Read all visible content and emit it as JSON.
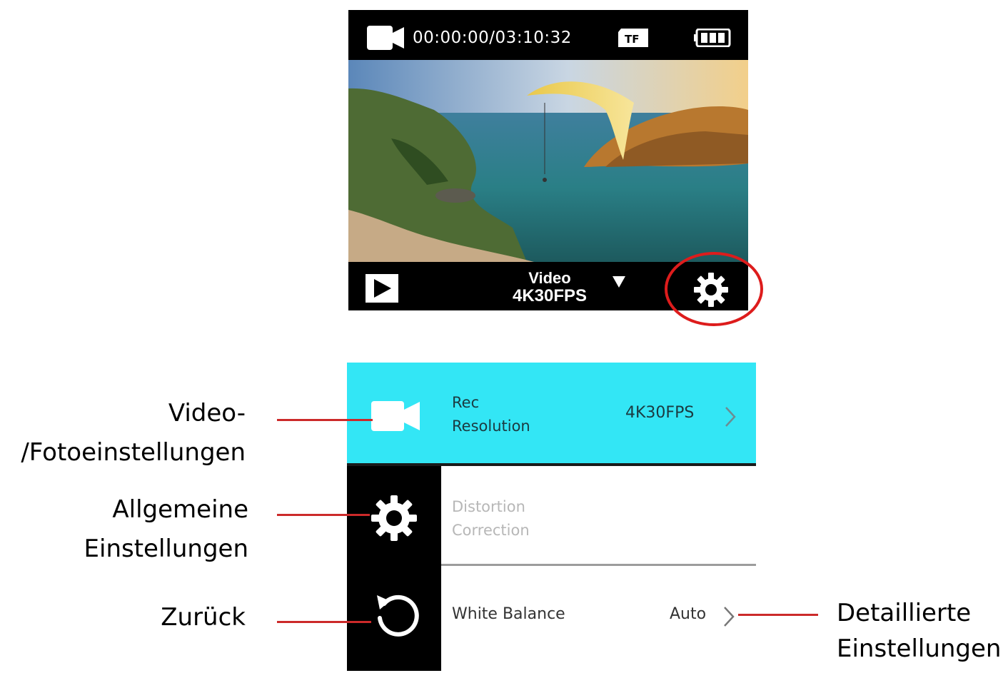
{
  "camera_screen": {
    "icons": {
      "mode": "video-camera-icon",
      "storage": "tf-card-icon",
      "battery": "battery-icon",
      "play": "play-icon",
      "dropdown": "triangle-down-icon",
      "settings": "gear-icon"
    },
    "timecode": "00:00:00/03:10:32",
    "storage_label": "TF",
    "battery_level": 1.0,
    "mode_line1": "Video",
    "mode_line2": "4K30FPS",
    "highlight_color": "#dd1c1c"
  },
  "settings_menu": {
    "accent_color": "#33e6f5",
    "sidebar_icons": [
      "video-camera-icon",
      "gear-icon",
      "back-arrow-icon"
    ],
    "items": [
      {
        "label_line1": "Rec",
        "label_line2": "Resolution",
        "value": "4K30FPS",
        "active": true
      },
      {
        "label_line1": "Distortion",
        "label_line2": "Correction",
        "value": "",
        "active": false
      },
      {
        "label_line1": "White Balance",
        "label_line2": "",
        "value": "Auto",
        "active": false
      }
    ]
  },
  "annotations": {
    "video_photo_line1": "Video-",
    "video_photo_line2": "/Fotoeinstellungen",
    "general_line1": "Allgemeine",
    "general_line2": "Einstellungen",
    "back": "Zurück",
    "detail_line1": "Detaillierte",
    "detail_line2": "Einstellungen",
    "leader_color": "#cc2a2a"
  }
}
